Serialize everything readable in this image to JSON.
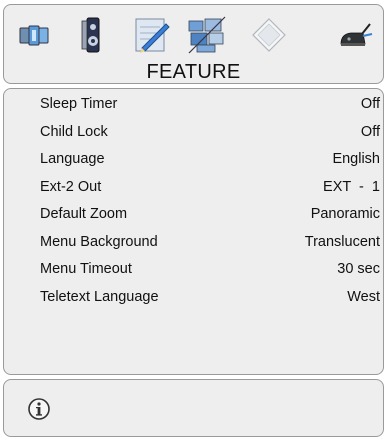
{
  "header": {
    "title": "FEATURE",
    "tabs": [
      {
        "icon": "picture-icon"
      },
      {
        "icon": "speaker-icon"
      },
      {
        "icon": "feature-pen-icon"
      },
      {
        "icon": "channel-grid-icon"
      },
      {
        "icon": "source-diamond-icon"
      },
      {
        "icon": "install-satellite-icon"
      }
    ]
  },
  "menu": {
    "items": [
      {
        "label": "Sleep Timer",
        "value": "Off"
      },
      {
        "label": "Child Lock",
        "value": "Off"
      },
      {
        "label": "Language",
        "value": "English"
      },
      {
        "label": "Ext-2 Out",
        "value": "EXT  -  1"
      },
      {
        "label": "Default Zoom",
        "value": "Panoramic"
      },
      {
        "label": "Menu Background",
        "value": "Translucent"
      },
      {
        "label": "Menu Timeout",
        "value": "30 sec"
      },
      {
        "label": "Teletext Language",
        "value": "West"
      }
    ]
  },
  "footer": {
    "icon": "info-icon"
  },
  "colors": {
    "panel_bg": "#eeeeee",
    "panel_border": "#9a9a9a",
    "accent_blue": "#3a7fd6"
  }
}
